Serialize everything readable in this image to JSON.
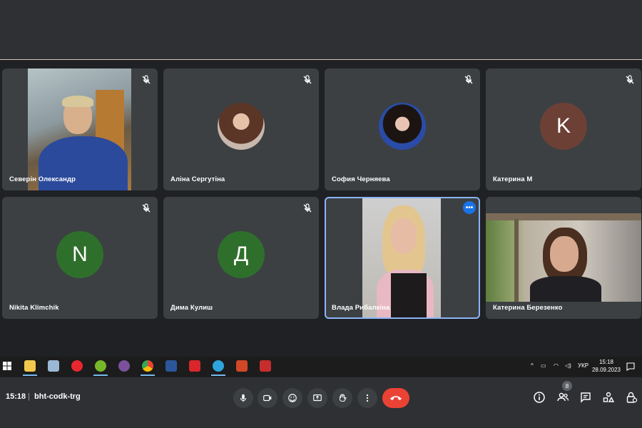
{
  "participants": [
    {
      "name": "Северін Олександр",
      "kind": "video",
      "muted": true
    },
    {
      "name": "Аліна Сергутіна",
      "kind": "photo",
      "muted": true
    },
    {
      "name": "София Черняева",
      "kind": "photo",
      "muted": true
    },
    {
      "name": "Катерина М",
      "kind": "letter",
      "letter": "K",
      "color": "#6d4036",
      "muted": true
    },
    {
      "name": "Nikita Klimchik",
      "kind": "letter",
      "letter": "N",
      "color": "#2f6f2c",
      "muted": true
    },
    {
      "name": "Дима Кулиш",
      "kind": "letter",
      "letter": "Д",
      "color": "#2f6f2c",
      "muted": true
    },
    {
      "name": "Влада Рибалкіна",
      "kind": "video",
      "muted": false,
      "speaking": true
    },
    {
      "name": "Катерина Березенко",
      "kind": "video",
      "muted": false
    }
  ],
  "meeting": {
    "time": "15:18",
    "separator": "|",
    "code": "bht-codk-trg",
    "people_count": "8"
  },
  "controls": [
    "mic-icon",
    "camera-icon",
    "emoji-icon",
    "present-icon",
    "raise-hand-icon",
    "more-options-icon",
    "end-call-icon"
  ],
  "right_controls": [
    "info-icon",
    "people-icon",
    "chat-icon",
    "activities-icon",
    "host-controls-icon"
  ],
  "taskbar": {
    "lang": "УКР",
    "time": "15:18",
    "date": "28.09.2023"
  },
  "colors": {
    "accent": "#1a73e8",
    "end_call": "#ea4335",
    "tile_bg": "#3c4043"
  }
}
